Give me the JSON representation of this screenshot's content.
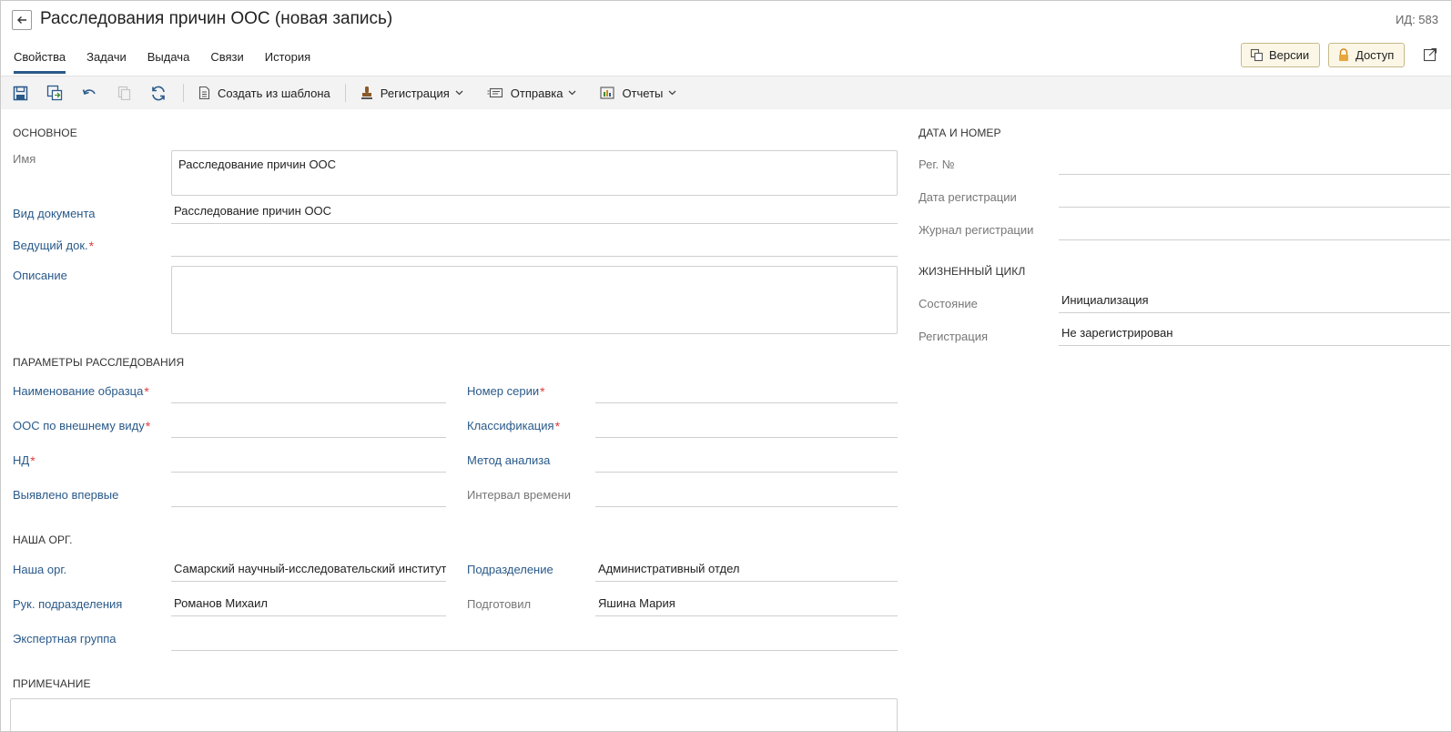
{
  "header": {
    "title": "Расследования причин ООС (новая запись)",
    "id_label": "ИД: 583"
  },
  "tabs": [
    {
      "label": "Свойства",
      "active": true
    },
    {
      "label": "Задачи"
    },
    {
      "label": "Выдача"
    },
    {
      "label": "Связи"
    },
    {
      "label": "История"
    }
  ],
  "top_buttons": {
    "versions": "Версии",
    "access": "Доступ"
  },
  "toolbar": {
    "create_from_template": "Создать из шаблона",
    "registration": "Регистрация",
    "send": "Отправка",
    "reports": "Отчеты"
  },
  "main": {
    "section": "ОСНОВНОЕ",
    "name_label": "Имя",
    "name_value": "Расследование причин ООС",
    "doc_kind_label": "Вид документа",
    "doc_kind_value": "Расследование причин ООС",
    "leading_doc_label": "Ведущий док.",
    "leading_doc_value": "",
    "description_label": "Описание",
    "description_value": ""
  },
  "investigation": {
    "section": "ПАРАМЕТРЫ РАССЛЕДОВАНИЯ",
    "sample_name_label": "Наименование образца",
    "sample_name_value": "",
    "oos_appearance_label": "ООС по внешнему виду",
    "oos_appearance_value": "",
    "nd_label": "НД",
    "nd_value": "",
    "first_detected_label": "Выявлено впервые",
    "first_detected_value": "",
    "series_number_label": "Номер серии",
    "series_number_value": "",
    "classification_label": "Классификация",
    "classification_value": "",
    "analysis_method_label": "Метод анализа",
    "analysis_method_value": "",
    "time_interval_label": "Интервал времени",
    "time_interval_value": ""
  },
  "our_org": {
    "section": "НАША ОРГ.",
    "org_label": "Наша орг.",
    "org_value": "Самарский научный-исследовательский институт",
    "dept_label": "Подразделение",
    "dept_value": "Административный отдел",
    "dept_head_label": "Рук. подразделения",
    "dept_head_value": "Романов Михаил",
    "prepared_label": "Подготовил",
    "prepared_value": "Яшина Мария",
    "expert_group_label": "Экспертная группа",
    "expert_group_value": ""
  },
  "note": {
    "section": "ПРИМЕЧАНИЕ",
    "value": ""
  },
  "date_number": {
    "section": "ДАТА И НОМЕР",
    "reg_no_label": "Рег. №",
    "reg_no_value": "",
    "reg_date_label": "Дата регистрации",
    "reg_date_value": "",
    "reg_journal_label": "Журнал регистрации",
    "reg_journal_value": ""
  },
  "lifecycle": {
    "section": "ЖИЗНЕННЫЙ ЦИКЛ",
    "state_label": "Состояние",
    "state_value": "Инициализация",
    "registration_label": "Регистрация",
    "registration_value": "Не зарегистрирован"
  },
  "colors": {
    "link_label": "#2a5a8a",
    "required": "#e23b3b",
    "toolbar_bg": "#f3f3f3",
    "accent_button_bg": "#fbf6e6"
  }
}
